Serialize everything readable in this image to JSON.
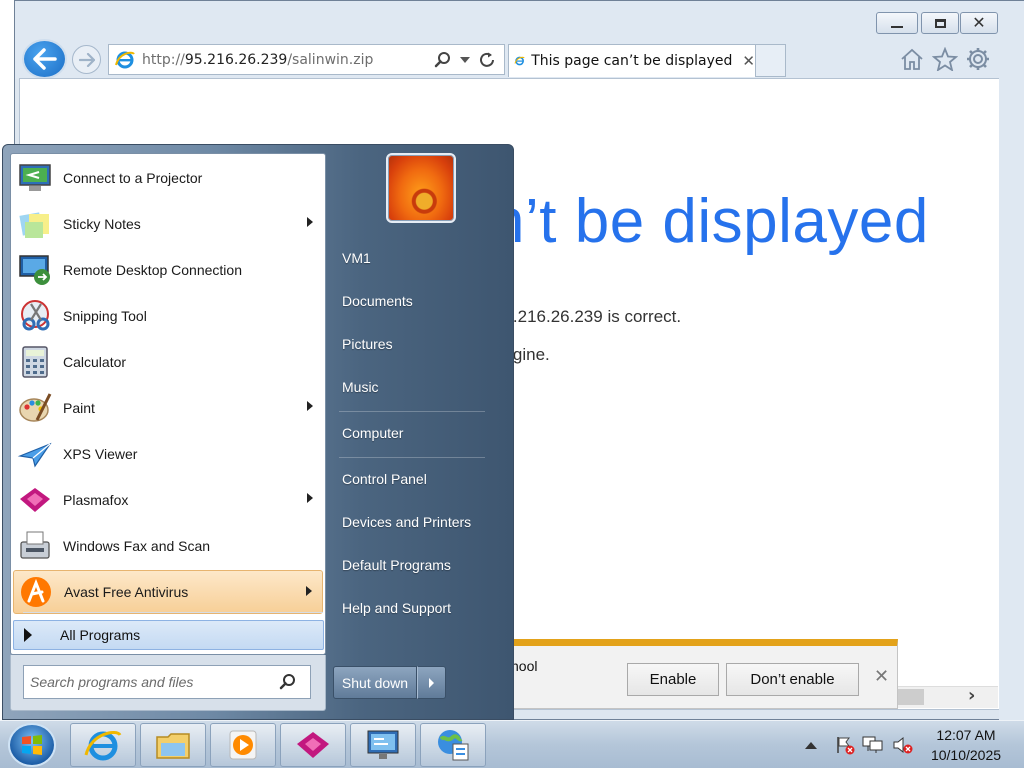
{
  "browser": {
    "address": {
      "scheme": "http://",
      "host": "95.216.26.239",
      "path": "/salinwin.zip"
    },
    "tab": {
      "title": "This page can’t be displayed"
    },
    "page": {
      "heading_visible": "n’t be displayed",
      "line1_visible": "95.216.26.239 is correct.",
      "line2_visible": "engine."
    },
    "notification": {
      "text_visible": "hool",
      "enable_label": "Enable",
      "dont_enable_label": "Don’t enable"
    }
  },
  "start_menu": {
    "programs": [
      {
        "label": "Connect to a Projector",
        "icon": "projector-icon",
        "submenu": false
      },
      {
        "label": "Sticky Notes",
        "icon": "sticky-notes-icon",
        "submenu": true
      },
      {
        "label": "Remote Desktop Connection",
        "icon": "remote-desktop-icon",
        "submenu": false
      },
      {
        "label": "Snipping Tool",
        "icon": "scissors-icon",
        "submenu": false
      },
      {
        "label": "Calculator",
        "icon": "calculator-icon",
        "submenu": false
      },
      {
        "label": "Paint",
        "icon": "paint-palette-icon",
        "submenu": true
      },
      {
        "label": "XPS Viewer",
        "icon": "paper-plane-icon",
        "submenu": false
      },
      {
        "label": "Plasmafox",
        "icon": "plasmafox-icon",
        "submenu": true
      },
      {
        "label": "Windows Fax and Scan",
        "icon": "fax-icon",
        "submenu": false
      },
      {
        "label": "Avast Free Antivirus",
        "icon": "avast-icon",
        "submenu": true,
        "highlighted": true
      }
    ],
    "all_programs_label": "All Programs",
    "search_placeholder": "Search programs and files",
    "right_items": [
      "VM1",
      "Documents",
      "Pictures",
      "Music",
      "Computer",
      "Control Panel",
      "Devices and Printers",
      "Default Programs",
      "Help and Support"
    ],
    "shutdown_label": "Shut down"
  },
  "taskbar": {
    "pinned": [
      "internet-explorer-icon",
      "file-explorer-icon",
      "media-player-icon",
      "plasmafox-icon",
      "presentation-icon",
      "globe-list-icon"
    ],
    "clock": {
      "time": "12:07 AM",
      "date": "10/10/2025"
    }
  },
  "colors": {
    "ie_blue": "#2672ec",
    "notification_accent": "#e3a21a",
    "start_highlight": "#f7cf97"
  }
}
